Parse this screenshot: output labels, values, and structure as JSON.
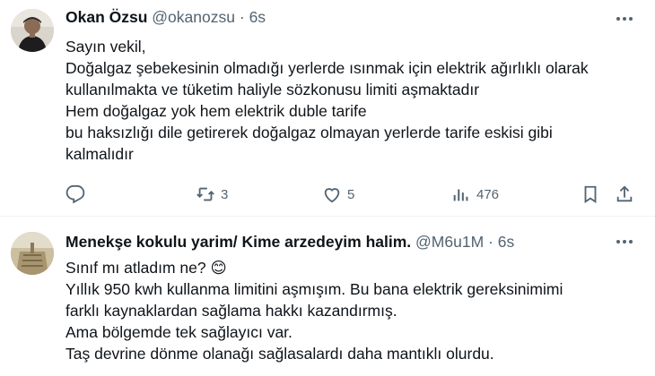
{
  "tweets": [
    {
      "author_name": "Okan Özsu",
      "handle": "@okanozsu",
      "separator": "·",
      "time": "6s",
      "lines": [
        "Sayın vekil,",
        "Doğalgaz şebekesinin olmadığı yerlerde ısınmak için elektrik ağırlıklı olarak",
        "kullanılmakta ve tüketim haliyle sözkonusu limiti aşmaktadır",
        "Hem doğalgaz yok hem elektrik duble tarife",
        "bu haksızlığı dile getirerek doğalgaz olmayan yerlerde tarife eskisi gibi",
        "kalmalıdır"
      ],
      "actions": {
        "reply_count": "",
        "retweet_count": "3",
        "like_count": "5",
        "views_count": "476"
      }
    },
    {
      "author_name": "Menekşe kokulu yarim/ Kime arzedeyim halim.",
      "handle": "@M6u1M",
      "separator": "·",
      "time": "6s",
      "lines": [
        "Sınıf mı atladım ne? 😊",
        "Yıllık 950 kwh kullanma limitini aşmışım. Bu bana elektrik gereksinimimi",
        "farklı kaynaklardan sağlama hakkı kazandırmış.",
        "Ama bölgemde tek sağlayıcı var.",
        "Taş devrine dönme olanağı sağlasalardı daha mantıklı olurdu."
      ]
    }
  ],
  "colors": {
    "text": "#0f1419",
    "muted": "#536471",
    "divider": "#eff3f4"
  },
  "icons": [
    "more-icon",
    "reply-icon",
    "retweet-icon",
    "like-icon",
    "views-icon",
    "bookmark-icon",
    "share-icon"
  ]
}
